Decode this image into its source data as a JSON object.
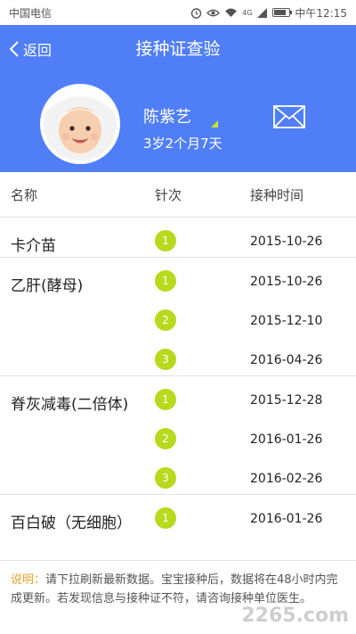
{
  "statusbar": {
    "carrier": "中国电信",
    "signal_text": "4G",
    "time": "中午12:15"
  },
  "nav": {
    "back_label": "返回",
    "title": "接种证查验"
  },
  "profile": {
    "name": "陈紫艺",
    "age": "3岁2个月7天"
  },
  "table": {
    "col_name": "名称",
    "col_dose": "针次",
    "col_date": "接种时间"
  },
  "vaccines": [
    {
      "name": "卡介苗",
      "doses": [
        {
          "num": "1",
          "date": "2015-10-26"
        }
      ]
    },
    {
      "name": "乙肝(酵母)",
      "doses": [
        {
          "num": "1",
          "date": "2015-10-26"
        },
        {
          "num": "2",
          "date": "2015-12-10"
        },
        {
          "num": "3",
          "date": "2016-04-26"
        }
      ]
    },
    {
      "name": "脊灰减毒(二倍体)",
      "doses": [
        {
          "num": "1",
          "date": "2015-12-28"
        },
        {
          "num": "2",
          "date": "2016-01-26"
        },
        {
          "num": "3",
          "date": "2016-02-26"
        }
      ]
    },
    {
      "name": "百白破（无细胞）",
      "doses": [
        {
          "num": "1",
          "date": "2016-01-26"
        }
      ]
    }
  ],
  "footer": {
    "label": "说明：",
    "text": "请下拉刷新最新数据。宝宝接种后，数据将在48小时内完成更新。若发现信息与接种证不符，请咨询接种单位医生。",
    "watermark": "2265.com"
  },
  "colors": {
    "header_bg": "#4f7ef7",
    "badge": "#b8d91c",
    "note_label": "#e8a32a"
  }
}
